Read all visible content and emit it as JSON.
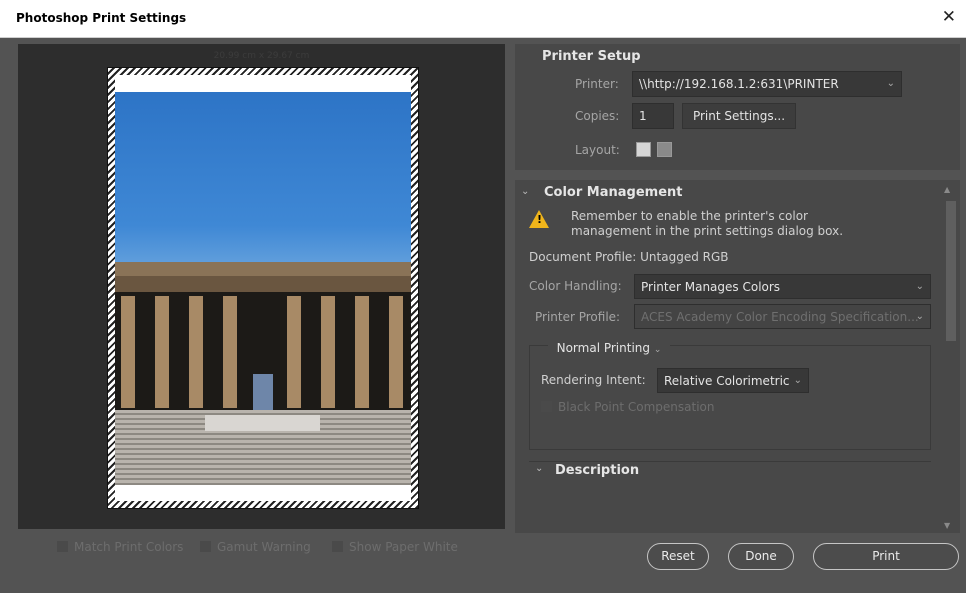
{
  "window": {
    "title": "Photoshop Print Settings",
    "close": "✕"
  },
  "preview": {
    "dimensions": "20.99 cm x 29.67 cm",
    "checkboxes": [
      "Match Print Colors",
      "Gamut Warning",
      "Show Paper White"
    ]
  },
  "printer_setup": {
    "title": "Printer Setup",
    "printer_label": "Printer:",
    "printer_value": "\\\\http://192.168.1.2:631\\PRINTER",
    "copies_label": "Copies:",
    "copies_value": "1",
    "print_settings_button": "Print Settings...",
    "layout_label": "Layout:"
  },
  "color_management": {
    "title": "Color Management",
    "warning_line1": "Remember to enable the printer's color",
    "warning_line2": "management in the print settings dialog box.",
    "document_profile": "Document Profile: Untagged RGB",
    "color_handling_label": "Color Handling:",
    "color_handling_value": "Printer Manages Colors",
    "printer_profile_label": "Printer Profile:",
    "printer_profile_value": "ACES Academy Color Encoding Specification...",
    "normal_printing": "Normal Printing",
    "rendering_intent_label": "Rendering Intent:",
    "rendering_intent_value": "Relative Colorimetric",
    "black_point": "Black Point Compensation"
  },
  "description": {
    "title": "Description"
  },
  "buttons": {
    "reset": "Reset",
    "done": "Done",
    "print": "Print"
  },
  "colors": {
    "background": "#535353",
    "panel": "#484848",
    "warning": "#f0b51b",
    "sky": "#2d74c6"
  }
}
